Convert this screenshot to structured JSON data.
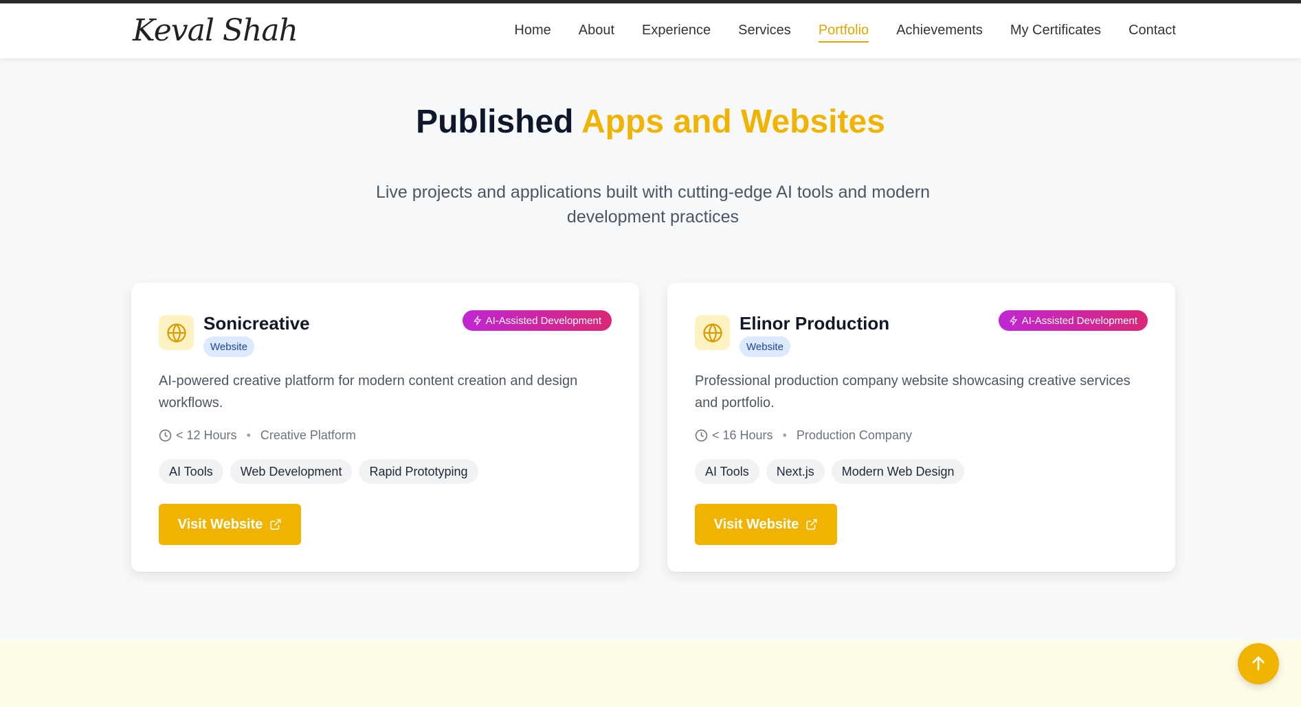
{
  "header": {
    "logo": "Keval Shah",
    "nav": [
      {
        "label": "Home",
        "active": false
      },
      {
        "label": "About",
        "active": false
      },
      {
        "label": "Experience",
        "active": false
      },
      {
        "label": "Services",
        "active": false
      },
      {
        "label": "Portfolio",
        "active": true
      },
      {
        "label": "Achievements",
        "active": false
      },
      {
        "label": "My Certificates",
        "active": false
      },
      {
        "label": "Contact",
        "active": false
      }
    ]
  },
  "section": {
    "title_main": "Published",
    "title_accent": "Apps and Websites",
    "subtitle": "Live projects and applications built with cutting-edge AI tools and modern development practices"
  },
  "projects": [
    {
      "title": "Sonicreative",
      "type": "Website",
      "badge": "AI-Assisted Development",
      "description": "AI-powered creative platform for modern content creation and design workflows.",
      "duration": "< 12 Hours",
      "category": "Creative Platform",
      "tags": [
        "AI Tools",
        "Web Development",
        "Rapid Prototyping"
      ],
      "button": "Visit Website"
    },
    {
      "title": "Elinor Production",
      "type": "Website",
      "badge": "AI-Assisted Development",
      "description": "Professional production company website showcasing creative services and portfolio.",
      "duration": "< 16 Hours",
      "category": "Production Company",
      "tags": [
        "AI Tools",
        "Next.js",
        "Modern Web Design"
      ],
      "button": "Visit Website"
    }
  ],
  "colors": {
    "accent": "#f0b400",
    "badge_gradient_start": "#c026d3",
    "badge_gradient_end": "#db2777",
    "type_badge_bg": "#dbeafe"
  }
}
